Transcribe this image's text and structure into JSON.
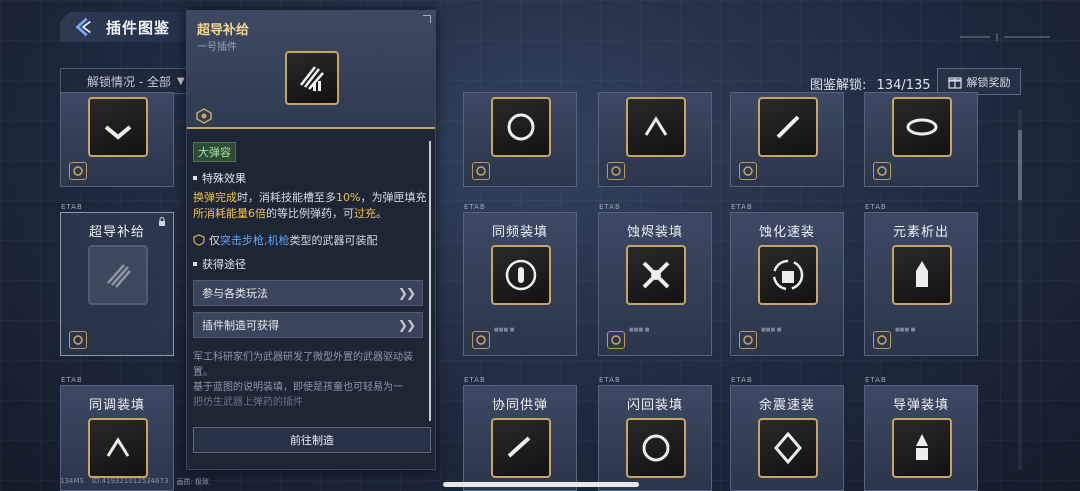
{
  "header": {
    "title": "插件图鉴",
    "filter_label": "解锁情况 - 全部",
    "unlock_label": "图鉴解锁:",
    "unlock_count": "134/135",
    "reward_button": "解锁奖励"
  },
  "popup": {
    "title": "超导补给",
    "subtitle": "一号插件",
    "tag": "大弹容",
    "special_effect_heading": "特殊效果",
    "effect_part1": "换弹完成",
    "effect_part2": "时，消耗技能槽至多",
    "effect_part3": "10%",
    "effect_part4": "，为弹匣填充",
    "effect_part5": "所消耗能量6倍",
    "effect_part6": "的等比例弹药，可",
    "effect_part7": "过充",
    "effect_part8": "。",
    "weapon_prefix": "仅",
    "weapon_types": "突击步枪,机枪",
    "weapon_suffix": "类型的武器可装配",
    "acquire_heading": "获得途径",
    "routes": [
      "参与各类玩法",
      "插件制造可获得"
    ],
    "lore_line1": "军工科研家们为武器研发了微型外置的武器驱动装置。",
    "lore_line2": "基于蓝图的说明装填，即使是孩童也可轻易为一",
    "lore_line3": "把仿生武器上弹药的插件",
    "goto_button": "前往制造"
  },
  "cards": {
    "row2": [
      "超导补给",
      "同频装填",
      "蚀烬装填",
      "蚀化速装",
      "元素析出"
    ],
    "row3": [
      "同调装填",
      "协同供弹",
      "闪回装填",
      "余震速装",
      "导弹装填"
    ],
    "tag_text": "ETAB"
  },
  "footer": {
    "ms": "134MS",
    "id": "ID:4193210125346​73",
    "quality": "画质: 极致"
  }
}
